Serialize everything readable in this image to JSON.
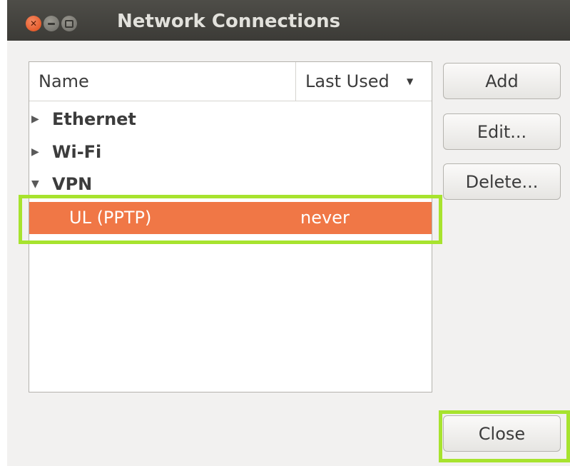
{
  "window": {
    "title": "Network Connections"
  },
  "list": {
    "columns": {
      "name": "Name",
      "last_used": "Last Used"
    },
    "groups": [
      {
        "label": "Ethernet",
        "expander": "▶"
      },
      {
        "label": "Wi-Fi",
        "expander": "▶"
      },
      {
        "label": "VPN",
        "expander": "▼"
      }
    ],
    "connections": [
      {
        "name": "UL (PPTP)",
        "last_used": "never",
        "selected": true
      }
    ]
  },
  "buttons": {
    "add": "Add",
    "edit": "Edit...",
    "delete": "Delete...",
    "close": "Close"
  },
  "icons": {
    "sort": "sort-descending-icon",
    "window_close": "window-close-icon",
    "window_minimize": "window-minimize-icon",
    "window_maximize": "window-maximize-icon"
  },
  "colors": {
    "selection": "#f07746",
    "highlight": "#a7e32e",
    "titlebar": "#3c3b37"
  }
}
